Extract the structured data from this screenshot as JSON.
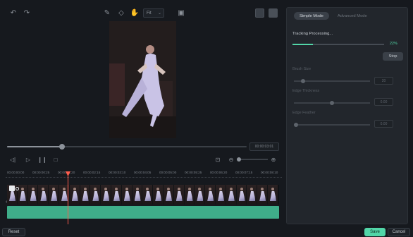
{
  "toolbar": {
    "fit_select": "Fit"
  },
  "preview": {
    "timecode": "00:00:03:01"
  },
  "timeline": {
    "ticks": [
      "00:00:00:00",
      "00:00:00:25",
      "00:00:01:20",
      "00:00:02:15",
      "00:00:03:10",
      "00:00:04:05",
      "00:00:05:00",
      "00:00:05:25",
      "00:00:06:20",
      "00:00:07:15",
      "00:00:08:10"
    ]
  },
  "panel": {
    "tabs": [
      "Simple Mode",
      "Advanced Mode"
    ],
    "processing_label": "Tracking Processing...",
    "progress_percent": "22%",
    "progress_value": 0.22,
    "stop_label": "Stop",
    "brush_size_label": "Brush Size",
    "brush_size_value": "20",
    "edge_thickness_label": "Edge Thickness",
    "edge_thickness_value": "0.00",
    "edge_feather_label": "Edge Feather",
    "edge_feather_value": "0.00"
  },
  "footer": {
    "reset_label": "Reset",
    "save_label": "Save",
    "cancel_label": "Cancel"
  },
  "colors": {
    "accent": "#52d6a8",
    "playhead": "#ff5c4d",
    "track": "#3fae8a"
  }
}
